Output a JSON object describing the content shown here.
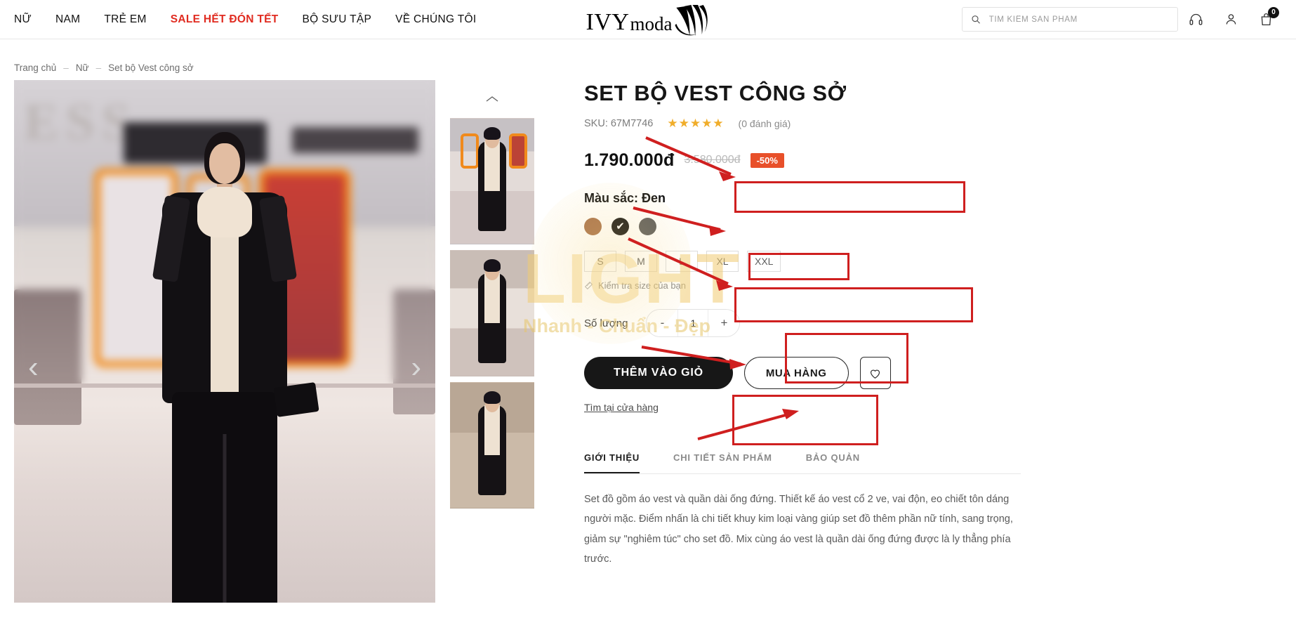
{
  "header": {
    "nav": [
      {
        "label": "NỮ",
        "sale": false
      },
      {
        "label": "NAM",
        "sale": false
      },
      {
        "label": "TRẺ EM",
        "sale": false
      },
      {
        "label": "SALE HẾT ĐÓN TẾT",
        "sale": true
      },
      {
        "label": "BỘ SƯU TẬP",
        "sale": false
      },
      {
        "label": "VỀ CHÚNG TÔI",
        "sale": false
      }
    ],
    "logo": {
      "primary": "IVY",
      "secondary": "moda"
    },
    "search": {
      "placeholder": "TÌM KIẾM SẢN PHẨM",
      "value": ""
    },
    "icons": [
      "headphones-icon",
      "user-icon",
      "cart-icon"
    ],
    "cart_count": "0"
  },
  "breadcrumb": {
    "items": [
      "Trang chủ",
      "Nữ",
      "Set bộ Vest công sở"
    ],
    "separator": "–"
  },
  "gallery": {
    "prev_arrow": "‹",
    "next_arrow": "›",
    "thumb_up_chevron": "⌃",
    "thumbnail_count": 3
  },
  "product": {
    "title": "SET BỘ VEST CÔNG SỞ",
    "sku_label": "SKU: 67M7746",
    "stars": "★★★★★",
    "rating_count": "(0 đánh giá)",
    "price_current": "1.790.000đ",
    "price_original": "3.580.000đ",
    "discount_badge": "-50%",
    "color_label": "Màu sắc: Đen",
    "colors": [
      {
        "name": "brown",
        "hex": "#a8714a",
        "selected": false
      },
      {
        "name": "black",
        "hex": "#141414",
        "selected": true
      },
      {
        "name": "gray",
        "hex": "#5c5c5c",
        "selected": false
      }
    ],
    "selected_color_check": "✔",
    "sizes": [
      "S",
      "M",
      "L",
      "XL",
      "XXL"
    ],
    "size_help": "Kiểm tra size của bạn",
    "size_help_icon": "ruler-icon",
    "qty_label": "Số lượng",
    "qty_minus": "-",
    "qty_value": "1",
    "qty_plus": "+",
    "add_to_cart": "THÊM VÀO GIỎ",
    "buy_now": "MUA HÀNG",
    "wishlist_icon": "heart-icon",
    "store_link": "Tìm tại cửa hàng",
    "tabs": [
      {
        "label": "GIỚI THIỆU",
        "active": true
      },
      {
        "label": "CHI TIẾT SẢN PHẨM",
        "active": false
      },
      {
        "label": "BẢO QUẢN",
        "active": false
      }
    ],
    "description": "Set đồ gồm áo vest và quần dài ống đứng. Thiết kế áo vest cổ 2 ve, vai độn, eo chiết tôn dáng người mặc. Điểm nhấn là chi tiết khuy kim loại vàng giúp set đồ thêm phần nữ tính, sang trọng, giảm sự \"nghiêm túc\" cho set đồ. Mix cùng áo vest là quần dài ống đứng được là ly thẳng phía trước."
  },
  "watermark": {
    "line1": "LIGHT",
    "line2": "Nhanh - Chuẩn - Đẹp"
  },
  "annotations": {
    "accent_color": "#cf1f1f",
    "boxes": [
      "price-box",
      "color-swatch-box",
      "size-box",
      "qty-box",
      "add-to-cart-box"
    ],
    "arrow_count": 5
  }
}
